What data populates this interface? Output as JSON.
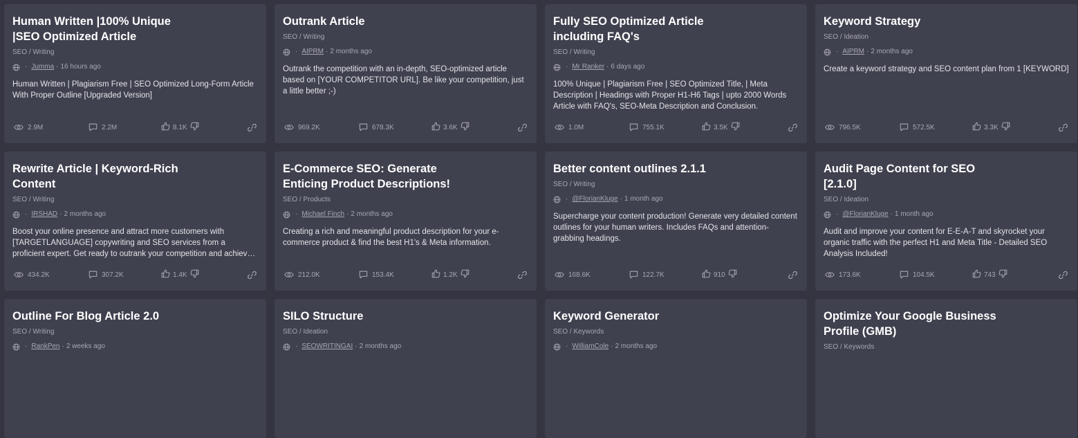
{
  "cards": [
    {
      "title": "Human Written |100% Unique |SEO Optimized Article",
      "category": "SEO / Writing",
      "author": "Jumma",
      "time": "16 hours ago",
      "description": "Human Written | Plagiarism Free | SEO Optimized Long-Form Article With Proper Outline [Upgraded Version]",
      "views": "2.9M",
      "comments": "2.2M",
      "likes": "8.1K"
    },
    {
      "title": "Outrank Article",
      "category": "SEO / Writing",
      "author": "AIPRM",
      "time": "2 months ago",
      "description": "Outrank the competition with an in-depth, SEO-optimized article based on [YOUR COMPETITOR URL]. Be like your competition, just a little better ;-)",
      "views": "969.2K",
      "comments": "678.3K",
      "likes": "3.6K"
    },
    {
      "title": "Fully SEO Optimized Article including FAQ's",
      "category": "SEO / Writing",
      "author": "Mr Ranker",
      "time": "6 days ago",
      "description": "100% Unique | Plagiarism Free | SEO Optimized Title, | Meta Description | Headings with Proper H1-H6 Tags | upto 2000 Words Article with FAQ's, SEO-Meta Description and Conclusion.",
      "views": "1.0M",
      "comments": "755.1K",
      "likes": "3.5K"
    },
    {
      "title": "Keyword Strategy",
      "category": "SEO / Ideation",
      "author": "AIPRM",
      "time": "2 months ago",
      "description": "Create a keyword strategy and SEO content plan from 1 [KEYWORD]",
      "views": "796.5K",
      "comments": "572.5K",
      "likes": "3.3K"
    },
    {
      "title": "Rewrite Article | Keyword-Rich Content",
      "category": "SEO / Writing",
      "author": "IRSHAD",
      "time": "2 months ago",
      "description": "Boost your online presence and attract more customers with [TARGETLANGUAGE] copywriting and SEO services from a proficient expert. Get ready to outrank your competition and achieve top search…",
      "views": "434.2K",
      "comments": "307.2K",
      "likes": "1.4K"
    },
    {
      "title": "E-Commerce SEO: Generate Enticing Product Descriptions!",
      "category": "SEO / Products",
      "author": "Michael Finch",
      "time": "2 months ago",
      "description": "Creating a rich and meaningful product description for your e-commerce product & find the best H1's & Meta information.",
      "views": "212.0K",
      "comments": "153.4K",
      "likes": "1.2K"
    },
    {
      "title": "Better content outlines 2.1.1",
      "category": "SEO / Writing",
      "author": "@FlorianKluge",
      "time": "1 month ago",
      "description": "Supercharge your content production! Generate very detailed content outlines for your human writers. Includes FAQs and attention-grabbing headings.",
      "views": "168.6K",
      "comments": "122.7K",
      "likes": "910"
    },
    {
      "title": "Audit Page Content for SEO [2.1.0]",
      "category": "SEO / Ideation",
      "author": "@FlorianKluge",
      "time": "1 month ago",
      "description": "Audit and improve your content for E-E-A-T and skyrocket your organic traffic with the perfect H1 and Meta Title - Detailed SEO Analysis Included!",
      "views": "173.6K",
      "comments": "104.5K",
      "likes": "743"
    },
    {
      "title": "Outline For Blog Article 2.0",
      "category": "SEO / Writing",
      "author": "RankPen",
      "time": "2 weeks ago",
      "description": "",
      "views": "",
      "comments": "",
      "likes": ""
    },
    {
      "title": "SILO Structure",
      "category": "SEO / Ideation",
      "author": "SEOWRITINGAI",
      "time": "2 months ago",
      "description": "",
      "views": "",
      "comments": "",
      "likes": ""
    },
    {
      "title": "Keyword Generator",
      "category": "SEO / Keywords",
      "author": "WilliamCole",
      "time": "2 months ago",
      "description": "",
      "views": "",
      "comments": "",
      "likes": ""
    },
    {
      "title": "Optimize Your Google Business Profile (GMB)",
      "category": "SEO / Keywords",
      "author": "",
      "time": "",
      "description": "",
      "views": "",
      "comments": "",
      "likes": ""
    }
  ],
  "icons": {
    "globe": "globe-icon",
    "views": "eye-icon",
    "comments": "comment-icon",
    "like": "thumbs-up-icon",
    "dislike": "thumbs-down-icon",
    "link": "link-icon"
  },
  "colors": {
    "background": "#343541",
    "card": "#40414f",
    "muted": "#a7a8b3"
  }
}
